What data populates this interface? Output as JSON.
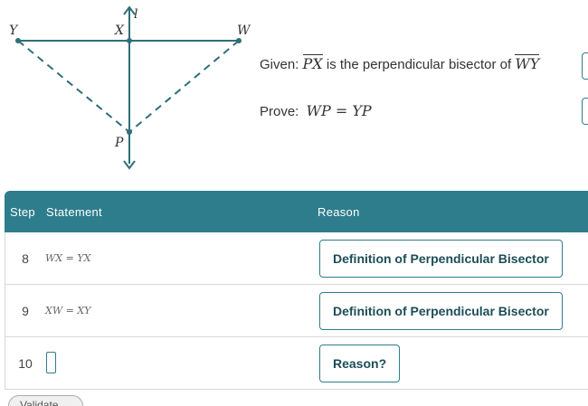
{
  "figure": {
    "labels": {
      "y": "Y",
      "x": "X",
      "w": "W",
      "l": "l",
      "p": "P"
    },
    "line_color": "#2e6e7a"
  },
  "given": {
    "prefix": "Given:",
    "segment1": "PX",
    "middle": "is the perpendicular bisector of",
    "segment2": "WY"
  },
  "prove": {
    "prefix": "Prove:",
    "expression": "WP = YP"
  },
  "table": {
    "header_color": "#2e7d8c",
    "columns": {
      "step": "Step",
      "statement": "Statement",
      "reason": "Reason"
    },
    "rows": [
      {
        "step": "8",
        "statement": "WX = YX",
        "reason": "Definition of Perpendicular Bisector"
      },
      {
        "step": "9",
        "statement": "XW = XY",
        "reason": "Definition of Perpendicular Bisector"
      },
      {
        "step": "10",
        "statement": "",
        "reason": "Reason?"
      }
    ]
  },
  "validate_label": "Validate"
}
